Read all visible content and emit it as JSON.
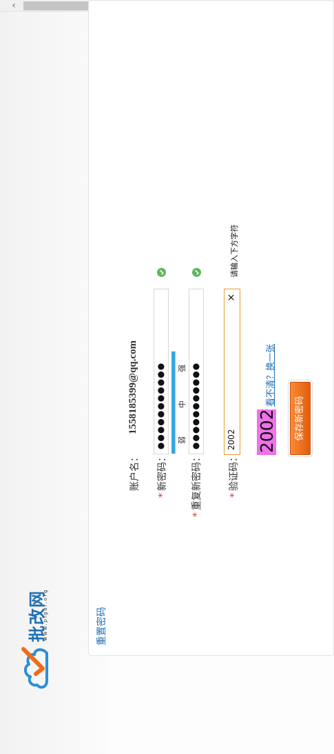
{
  "browser": {
    "scroll_left_icon": "chevron-left-icon",
    "scroll_right_icon": "chevron-right-icon",
    "left_arrow": "‹",
    "right_arrow": "›"
  },
  "logo": {
    "name": "批改网",
    "url": "www.pigai.org"
  },
  "form": {
    "title": "重置密码",
    "account_label": "账户名：",
    "account_value": "1558185399@qq.com",
    "required_mark": "*",
    "new_password_label": "新密码：",
    "new_password_value": "●●●●●●●●●●●",
    "confirm_password_label": "重复新密码：",
    "confirm_password_value": "●●●●●●●●●●●",
    "strength": {
      "weak": "弱",
      "medium": "中",
      "strong": "强",
      "level": "strong"
    },
    "captcha_label": "验证码：",
    "captcha_value": "2002",
    "captcha_clear": "×",
    "captcha_hint": "请输入下方字符",
    "captcha_image_text": "2002",
    "captcha_refresh_prefix": "看不清？",
    "captcha_refresh_link": "换一张",
    "submit_label": "保存新密码"
  },
  "colors": {
    "accent": "#1f6fb5",
    "required": "#e0302a",
    "success": "#5cb85c",
    "button": "#f07521",
    "captcha_bg": "#ef72e8"
  }
}
